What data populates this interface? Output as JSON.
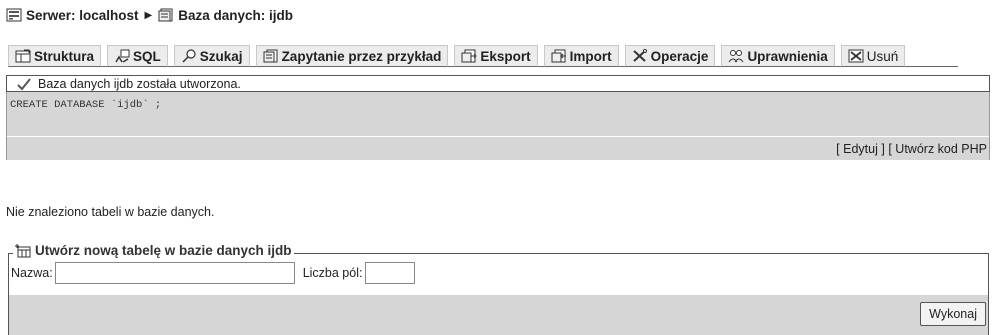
{
  "breadcrumb": {
    "server_label": "Serwer: localhost",
    "separator": "▶",
    "database_label": "Baza danych: ijdb",
    "server_icon": "server-icon",
    "database_icon": "database-icon"
  },
  "tabs": [
    {
      "label": "Struktura",
      "icon": "structure-icon"
    },
    {
      "label": "SQL",
      "icon": "sql-icon"
    },
    {
      "label": "Szukaj",
      "icon": "search-icon"
    },
    {
      "label": "Zapytanie przez przykład",
      "icon": "query-icon"
    },
    {
      "label": "Eksport",
      "icon": "export-icon"
    },
    {
      "label": "Import",
      "icon": "import-icon"
    },
    {
      "label": "Operacje",
      "icon": "operations-icon"
    },
    {
      "label": "Uprawnienia",
      "icon": "privileges-icon"
    },
    {
      "label": "Usuń",
      "icon": "drop-icon"
    }
  ],
  "notice": {
    "message": "Baza danych ijdb została utworzona.",
    "icon": "checkmark-icon"
  },
  "sql": {
    "query": "CREATE DATABASE `ijdb` ;",
    "edit_link": "Edytuj",
    "php_link": "Utwórz kod PHP",
    "bracket_open": "[",
    "bracket_close": "]"
  },
  "no_tables_message": "Nie znaleziono tabeli w bazie danych.",
  "create_table": {
    "legend": "Utwórz nową tabelę w bazie danych ijdb",
    "legend_icon": "new-table-icon",
    "name_label": "Nazwa:",
    "name_value": "",
    "fields_label": "Liczba pól:",
    "fields_value": "",
    "submit_label": "Wykonaj"
  },
  "colors": {
    "panel_gray": "#d6d6d6",
    "tab_gray": "#ececec",
    "border": "#555555"
  }
}
